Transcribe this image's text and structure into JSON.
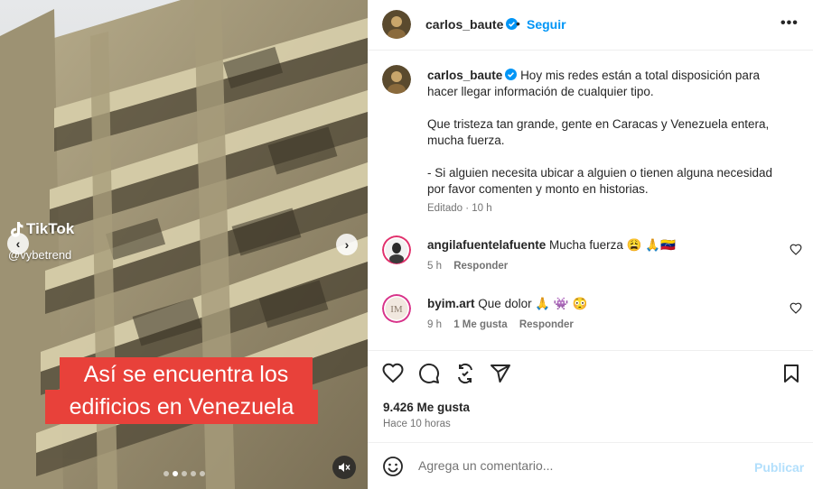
{
  "media": {
    "watermark_logo": "TikTok",
    "watermark_handle": "@vybetrend",
    "caption_line1": "Así se encuentra los",
    "caption_line2": "edificios en Venezuela",
    "carousel_total": 5,
    "carousel_active": 2
  },
  "header": {
    "username": "carlos_baute",
    "separator": "•",
    "follow_label": "Seguir",
    "more_label": "•••"
  },
  "caption": {
    "username": "carlos_baute",
    "paragraph1": "Hoy mis redes están a total disposición para hacer llegar información de cualquier tipo.",
    "paragraph2": "Que tristeza tan grande, gente en Caracas y Venezuela entera, mucha fuerza.",
    "paragraph3": "- Si alguien necesita ubicar a alguien o tienen alguna necesidad por favor comenten y monto en historias.",
    "edited_label": "Editado",
    "edited_sep": "·",
    "time": "10 h"
  },
  "comments": [
    {
      "username": "angilafuentelafuente",
      "text": "Mucha fuerza 😩 🙏🇻🇪",
      "time": "5 h",
      "likes": "",
      "reply_label": "Responder"
    },
    {
      "username": "byim.art",
      "text": "Que dolor 🙏 👾 😳",
      "time": "9 h",
      "likes": "1 Me gusta",
      "reply_label": "Responder"
    }
  ],
  "stats": {
    "likes": "9.426 Me gusta",
    "posted": "Hace 10 horas"
  },
  "comment_bar": {
    "placeholder": "Agrega un comentario...",
    "post_label": "Publicar"
  },
  "colors": {
    "link_blue": "#0095f6",
    "post_disabled": "#b2dffc",
    "caption_red": "#e8413a",
    "secondary_text": "#737373"
  }
}
